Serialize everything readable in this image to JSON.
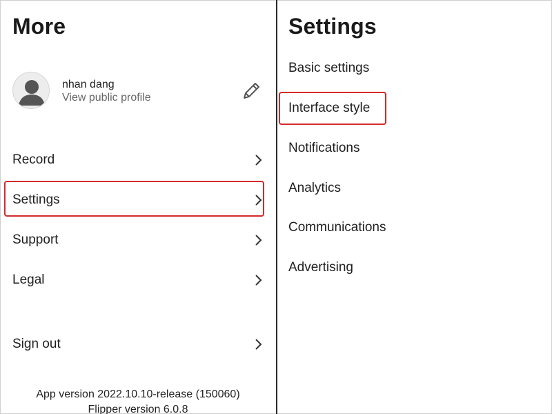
{
  "more_panel": {
    "title": "More",
    "profile": {
      "name": "nhan dang",
      "link_text": "View public profile"
    },
    "menu": [
      {
        "label": "Record"
      },
      {
        "label": "Settings"
      },
      {
        "label": "Support"
      },
      {
        "label": "Legal"
      },
      {
        "label": "Sign out"
      }
    ],
    "footer": {
      "app_version": "App version 2022.10.10-release (150060)",
      "flipper_version": "Flipper version 6.0.8"
    }
  },
  "settings_panel": {
    "title": "Settings",
    "items": [
      {
        "label": "Basic settings"
      },
      {
        "label": "Interface style"
      },
      {
        "label": "Notifications"
      },
      {
        "label": "Analytics"
      },
      {
        "label": "Communications"
      },
      {
        "label": "Advertising"
      }
    ]
  },
  "colors": {
    "highlight": "#d32a2a",
    "text": "#1f1f1f",
    "secondary_text": "#666666",
    "divider": "#2a2a2a"
  },
  "icons": {
    "avatar": "avatar-placeholder-icon",
    "edit": "pencil-icon",
    "chevron": "chevron-right-icon"
  }
}
